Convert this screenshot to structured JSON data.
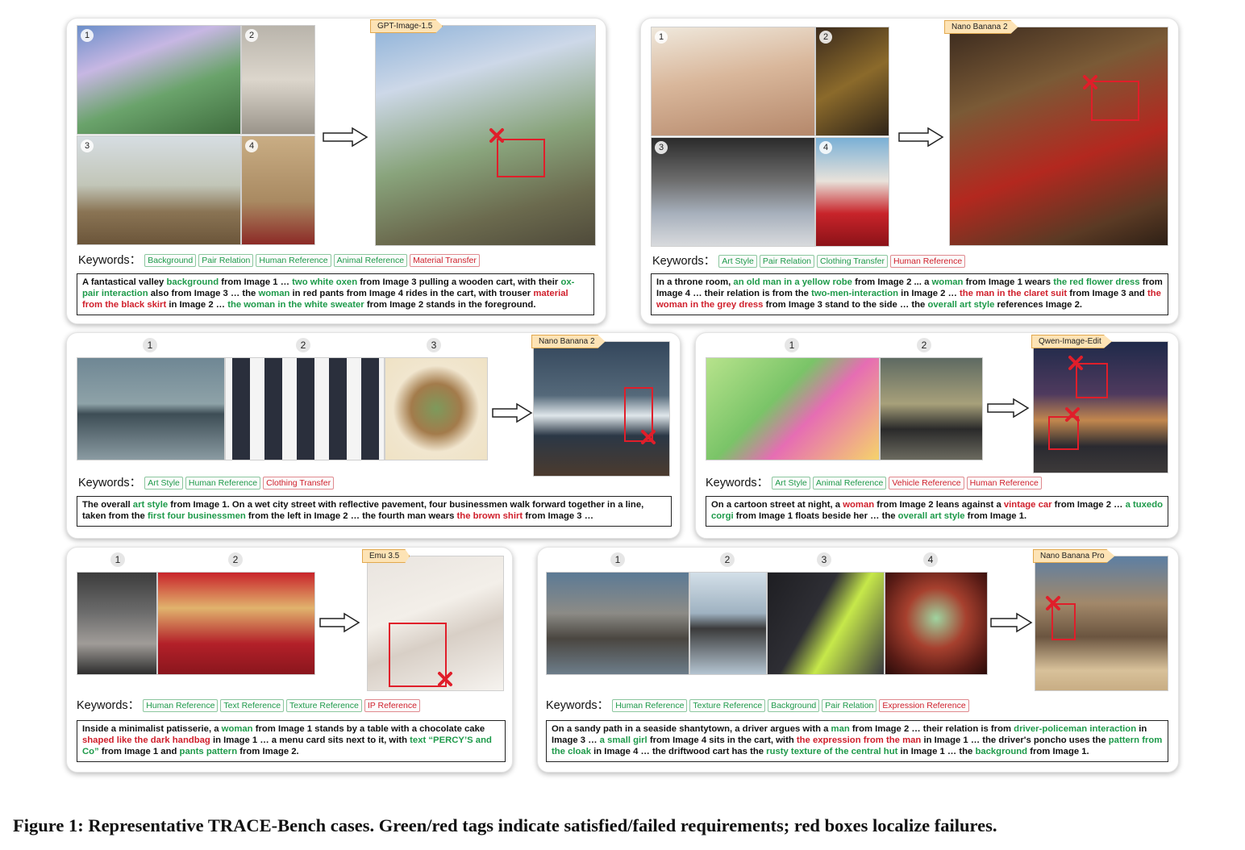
{
  "caption": "Figure 1: Representative TRACE-Bench cases. Green/red tags indicate satisfied/failed requirements; red boxes localize failures.",
  "keywords_label": "Keywords：",
  "cases": [
    {
      "model": "GPT-Image-1.5",
      "inputs": [
        "1",
        "2",
        "3",
        "4"
      ],
      "tags": [
        {
          "text": "Background",
          "status": "satisfied"
        },
        {
          "text": "Pair Relation",
          "status": "satisfied"
        },
        {
          "text": "Human Reference",
          "status": "satisfied"
        },
        {
          "text": "Animal Reference",
          "status": "satisfied"
        },
        {
          "text": "Material Transfer",
          "status": "failed"
        }
      ],
      "prompt": [
        {
          "t": "A fantastical valley ",
          "c": ""
        },
        {
          "t": "background",
          "c": "g"
        },
        {
          "t": " from Image 1 … ",
          "c": ""
        },
        {
          "t": "two white oxen",
          "c": "g"
        },
        {
          "t": " from Image 3 pulling a wooden cart, with their ",
          "c": ""
        },
        {
          "t": "ox-pair interaction",
          "c": "g"
        },
        {
          "t": " also from Image 3 … the ",
          "c": ""
        },
        {
          "t": "woman",
          "c": "g"
        },
        {
          "t": " in red pants from Image 4 rides in the cart, with trouser ",
          "c": ""
        },
        {
          "t": "material from the black skirt",
          "c": "r"
        },
        {
          "t": " in Image 2 … ",
          "c": ""
        },
        {
          "t": "the woman in the white sweater",
          "c": "g"
        },
        {
          "t": " from Image 2 stands in the foreground.",
          "c": ""
        }
      ]
    },
    {
      "model": "Nano Banana 2",
      "inputs": [
        "1",
        "2",
        "3",
        "4"
      ],
      "tags": [
        {
          "text": "Art Style",
          "status": "satisfied"
        },
        {
          "text": "Pair Relation",
          "status": "satisfied"
        },
        {
          "text": "Clothing Transfer",
          "status": "satisfied"
        },
        {
          "text": "Human Reference",
          "status": "failed"
        }
      ],
      "prompt": [
        {
          "t": "In a throne room, ",
          "c": ""
        },
        {
          "t": "an old man in a yellow robe",
          "c": "g"
        },
        {
          "t": " from Image 2 ... a ",
          "c": ""
        },
        {
          "t": "woman",
          "c": "g"
        },
        {
          "t": " from Image 1 wears ",
          "c": ""
        },
        {
          "t": "the red flower dress",
          "c": "g"
        },
        {
          "t": " from Image 4 … their relation is from the ",
          "c": ""
        },
        {
          "t": "two-men-interaction",
          "c": "g"
        },
        {
          "t": " in Image 2 … ",
          "c": ""
        },
        {
          "t": "the man in the claret suit",
          "c": "r"
        },
        {
          "t": " from Image 3 and ",
          "c": ""
        },
        {
          "t": "the woman in the grey dress",
          "c": "r"
        },
        {
          "t": " from Image 3 stand to the side … the ",
          "c": ""
        },
        {
          "t": "overall art style",
          "c": "g"
        },
        {
          "t": " references Image 2.",
          "c": ""
        }
      ]
    },
    {
      "model": "Nano Banana 2",
      "inputs": [
        "1",
        "2",
        "3"
      ],
      "tags": [
        {
          "text": "Art Style",
          "status": "satisfied"
        },
        {
          "text": "Human Reference",
          "status": "satisfied"
        },
        {
          "text": "Clothing Transfer",
          "status": "failed"
        }
      ],
      "prompt": [
        {
          "t": "The overall ",
          "c": ""
        },
        {
          "t": "art style",
          "c": "g"
        },
        {
          "t": " from Image 1. On a wet city street with reflective pavement, four businessmen walk forward together in a line, taken from the ",
          "c": ""
        },
        {
          "t": "first four businessmen",
          "c": "g"
        },
        {
          "t": " from the left in Image 2 … the fourth man wears ",
          "c": ""
        },
        {
          "t": "the brown shirt",
          "c": "r"
        },
        {
          "t": " from Image 3 …",
          "c": ""
        }
      ]
    },
    {
      "model": "Qwen-Image-Edit",
      "inputs": [
        "1",
        "2"
      ],
      "tags": [
        {
          "text": "Art Style",
          "status": "satisfied"
        },
        {
          "text": "Animal Reference",
          "status": "satisfied"
        },
        {
          "text": "Vehicle Reference",
          "status": "failed"
        },
        {
          "text": "Human Reference",
          "status": "failed"
        }
      ],
      "prompt": [
        {
          "t": "On a cartoon street at night, a ",
          "c": ""
        },
        {
          "t": "woman",
          "c": "r"
        },
        {
          "t": " from Image 2 leans against a ",
          "c": ""
        },
        {
          "t": "vintage car",
          "c": "r"
        },
        {
          "t": " from Image 2 … ",
          "c": ""
        },
        {
          "t": "a tuxedo corgi",
          "c": "g"
        },
        {
          "t": " from Image 1 floats beside her … the ",
          "c": ""
        },
        {
          "t": "overall art style",
          "c": "g"
        },
        {
          "t": " from Image 1.",
          "c": ""
        }
      ]
    },
    {
      "model": "Emu 3.5",
      "inputs": [
        "1",
        "2"
      ],
      "tags": [
        {
          "text": "Human Reference",
          "status": "satisfied"
        },
        {
          "text": "Text Reference",
          "status": "satisfied"
        },
        {
          "text": "Texture Reference",
          "status": "satisfied"
        },
        {
          "text": "IP Reference",
          "status": "failed"
        }
      ],
      "prompt": [
        {
          "t": "Inside a minimalist patisserie, a ",
          "c": ""
        },
        {
          "t": "woman",
          "c": "g"
        },
        {
          "t": " from Image 1 stands by a table with a chocolate cake ",
          "c": ""
        },
        {
          "t": "shaped like the dark handbag",
          "c": "r"
        },
        {
          "t": " in Image 1 … a menu card sits next to it, with ",
          "c": ""
        },
        {
          "t": "text “PERCY’S and Co”",
          "c": "g"
        },
        {
          "t": " from Image 1 and ",
          "c": ""
        },
        {
          "t": "pants pattern",
          "c": "g"
        },
        {
          "t": " from Image 2.",
          "c": ""
        }
      ]
    },
    {
      "model": "Nano Banana Pro",
      "inputs": [
        "1",
        "2",
        "3",
        "4"
      ],
      "tags": [
        {
          "text": "Human Reference",
          "status": "satisfied"
        },
        {
          "text": "Texture Reference",
          "status": "satisfied"
        },
        {
          "text": "Background",
          "status": "satisfied"
        },
        {
          "text": "Pair Relation",
          "status": "satisfied"
        },
        {
          "text": "Expression Reference",
          "status": "failed"
        }
      ],
      "prompt": [
        {
          "t": "On a sandy path in a seaside shantytown, a driver argues with a ",
          "c": ""
        },
        {
          "t": "man",
          "c": "g"
        },
        {
          "t": " from Image 2 … their relation is from ",
          "c": ""
        },
        {
          "t": "driver-policeman interaction",
          "c": "g"
        },
        {
          "t": " in Image 3 … ",
          "c": ""
        },
        {
          "t": "a small girl",
          "c": "g"
        },
        {
          "t": " from Image 4 sits in the cart, with ",
          "c": ""
        },
        {
          "t": "the expression from the man",
          "c": "r"
        },
        {
          "t": " in Image 1 … the driver's poncho uses the ",
          "c": ""
        },
        {
          "t": "pattern from the cloak",
          "c": "g"
        },
        {
          "t": " in Image 4 … the driftwood cart has the ",
          "c": ""
        },
        {
          "t": "rusty texture of the central hut",
          "c": "g"
        },
        {
          "t": " in Image 1 … the ",
          "c": ""
        },
        {
          "t": "background",
          "c": "g"
        },
        {
          "t": " from Image 1.",
          "c": ""
        }
      ]
    }
  ]
}
